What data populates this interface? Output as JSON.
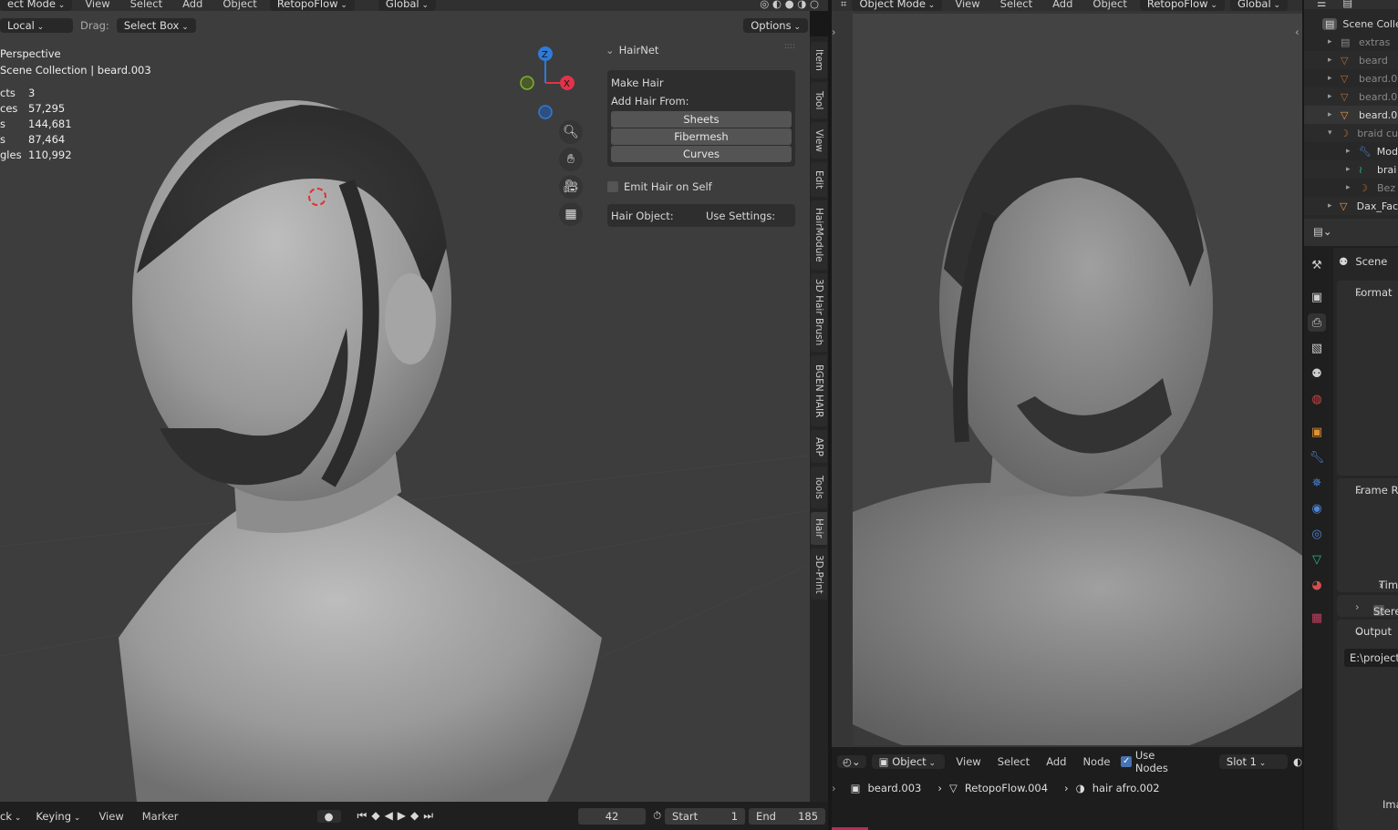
{
  "left_header": {
    "mode": "ect Mode",
    "menus": [
      "View",
      "Select",
      "Add",
      "Object"
    ],
    "retopo": "RetopoFlow",
    "orientation": "Global"
  },
  "tool_header": {
    "transform_space": "Local",
    "drag_label": "Drag:",
    "drag_value": "Select Box",
    "options": "Options"
  },
  "viewport_overlay": {
    "view_name": "Perspective",
    "collection": "Scene Collection | beard.003",
    "stats": [
      {
        "label": "cts",
        "value": "3"
      },
      {
        "label": "ces",
        "value": "57,295"
      },
      {
        "label": "s",
        "value": "144,681"
      },
      {
        "label": "s",
        "value": "87,464"
      },
      {
        "label": "gles",
        "value": "110,992"
      }
    ]
  },
  "gizmo": {
    "z": "Z",
    "x": "X",
    "colors": {
      "z": "#2f7bd6",
      "x": "#e0344a",
      "y": "#7db32a"
    }
  },
  "hairnet": {
    "title": "HairNet",
    "make_hair": "Make Hair",
    "add_from": "Add Hair From:",
    "buttons": [
      "Sheets",
      "Fibermesh",
      "Curves"
    ],
    "emit_label": "Emit Hair on Self",
    "emit_checked": false,
    "hair_object": "Hair Object:",
    "use_settings": "Use Settings:"
  },
  "sidebar_tabs": [
    "Item",
    "Tool",
    "View",
    "Edit",
    "HairModule",
    "3D Hair Brush",
    "BGEN HAIR",
    "ARP",
    "Tools",
    "Hair",
    "3D-Print"
  ],
  "timeline": {
    "menus": [
      "ck",
      "Keying",
      "View",
      "Marker"
    ],
    "current_frame": "42",
    "start_label": "Start",
    "start": "1",
    "end_label": "End",
    "end": "185"
  },
  "right_header": {
    "mode": "Object Mode",
    "menus": [
      "View",
      "Select",
      "Add",
      "Object"
    ],
    "retopo": "RetopoFlow",
    "orientation": "Global"
  },
  "shader_header": {
    "object": "Object",
    "menus": [
      "View",
      "Select",
      "Add",
      "Node"
    ],
    "use_nodes": "Use Nodes",
    "use_nodes_checked": true,
    "slot": "Slot 1"
  },
  "breadcrumb": [
    {
      "icon": "object-icon",
      "label": "beard.003"
    },
    {
      "icon": "mesh-icon",
      "label": "RetopoFlow.004"
    },
    {
      "icon": "material-icon",
      "label": "hair afro.002"
    }
  ],
  "outliner": {
    "root": "Scene Colle",
    "items": [
      {
        "label": "extras",
        "icon": "collection-icon",
        "color": "#8a8a8a",
        "dim": true,
        "indent": 0
      },
      {
        "label": "beard",
        "icon": "mesh-icon",
        "color": "#b0703a",
        "dim": true,
        "indent": 0
      },
      {
        "label": "beard.0",
        "icon": "mesh-icon",
        "color": "#b0703a",
        "dim": true,
        "indent": 0
      },
      {
        "label": "beard.0",
        "icon": "mesh-icon",
        "color": "#b0703a",
        "dim": true,
        "indent": 0
      },
      {
        "label": "beard.0",
        "icon": "mesh-icon",
        "color": "#e89a4a",
        "dim": false,
        "indent": 0
      },
      {
        "label": "braid cu",
        "icon": "curve-icon",
        "color": "#b0703a",
        "dim": true,
        "indent": 0
      },
      {
        "label": "Mod",
        "icon": "wrench-icon",
        "color": "#4d86d6",
        "dim": false,
        "indent": 1
      },
      {
        "label": "brai",
        "icon": "curve-data-icon",
        "color": "#2fb38a",
        "dim": false,
        "indent": 1
      },
      {
        "label": "Bez",
        "icon": "curve-icon",
        "color": "#b0703a",
        "dim": true,
        "indent": 1
      },
      {
        "label": "Dax_Fac",
        "icon": "mesh-icon",
        "color": "#e89a4a",
        "dim": false,
        "indent": 0
      }
    ]
  },
  "properties": {
    "scene": "Scene",
    "sections": [
      "Format",
      "Frame Ra",
      "Time S",
      "Stereo",
      "Output"
    ],
    "output_path": "E:\\project",
    "ima": "Ima"
  }
}
